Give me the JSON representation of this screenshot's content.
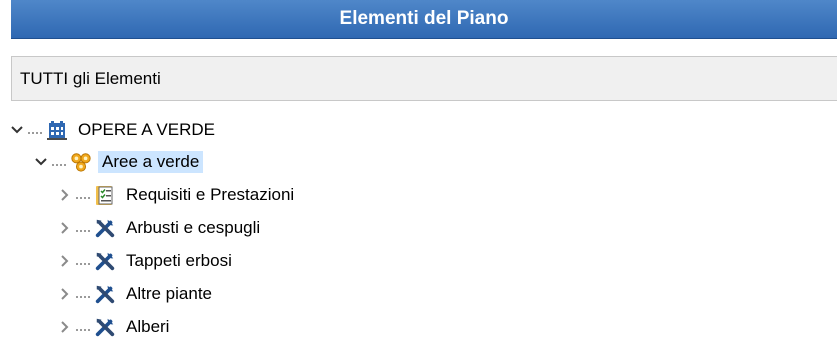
{
  "panel": {
    "title": "Elementi del Piano"
  },
  "filter": {
    "value": "TUTTI gli Elementi"
  },
  "tree": {
    "root": {
      "label": "OPERE A VERDE",
      "icon": "building-icon",
      "state": "expanded"
    },
    "area": {
      "label": "Aree a verde",
      "icon": "gears-icon",
      "state": "expanded",
      "selected": true
    },
    "children": [
      {
        "label": "Requisiti e Prestazioni",
        "icon": "checklist-document-icon",
        "state": "collapsed"
      },
      {
        "label": "Arbusti e cespugli",
        "icon": "tools-icon",
        "state": "collapsed"
      },
      {
        "label": "Tappeti erbosi",
        "icon": "tools-icon",
        "state": "collapsed"
      },
      {
        "label": "Altre piante",
        "icon": "tools-icon",
        "state": "collapsed"
      },
      {
        "label": "Alberi",
        "icon": "tools-icon",
        "state": "collapsed"
      }
    ]
  },
  "colors": {
    "title_bar": "#3a74bd",
    "selection": "#cce5ff",
    "tools_icon": "#1f4f8f"
  }
}
